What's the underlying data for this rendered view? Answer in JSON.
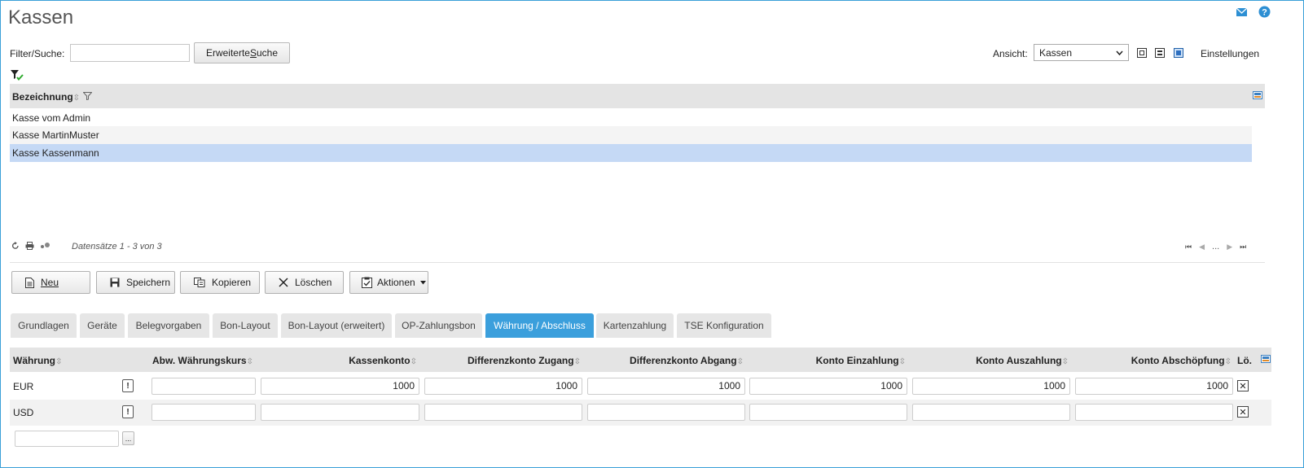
{
  "page": {
    "title": "Kassen"
  },
  "toolbar": {
    "filter_label": "Filter/Suche:",
    "filter_value": "",
    "advanced_search_pre": "Erweiterte ",
    "advanced_search_ul": "S",
    "advanced_search_post": "uche",
    "view_label": "Ansicht:",
    "view_selected": "Kassen",
    "settings_label": "Einstellungen"
  },
  "list": {
    "column_header": "Bezeichnung",
    "rows": [
      "Kasse vom Admin",
      "Kasse MartinMuster",
      "Kasse Kassenmann"
    ],
    "selected_index": 2,
    "records_text": "Datensätze 1 - 3 von 3",
    "pager_ellipsis": "..."
  },
  "actions": {
    "neu": "Neu",
    "speichern": "Speichern",
    "kopieren": "Kopieren",
    "loeschen": "Löschen",
    "aktionen": "Aktionen"
  },
  "tabs": [
    "Grundlagen",
    "Geräte",
    "Belegvorgaben",
    "Bon-Layout",
    "Bon-Layout (erweitert)",
    "OP-Zahlungsbon",
    "Währung / Abschluss",
    "Kartenzahlung",
    "TSE Konfiguration"
  ],
  "active_tab_index": 6,
  "currency_table": {
    "headers": {
      "waehrung": "Währung",
      "abw_kurs": "Abw. Währungskurs",
      "kassenkonto": "Kassenkonto",
      "diff_zugang": "Differenzkonto Zugang",
      "diff_abgang": "Differenzkonto Abgang",
      "konto_einzahlung": "Konto Einzahlung",
      "konto_auszahlung": "Konto Auszahlung",
      "konto_abschoepfung": "Konto Abschöpfung",
      "loeschen": "Lö."
    },
    "rows": [
      {
        "currency": "EUR",
        "abw_kurs": "",
        "kassenkonto": "1000",
        "diff_zugang": "1000",
        "diff_abgang": "1000",
        "konto_einzahlung": "1000",
        "konto_auszahlung": "1000",
        "konto_abschoepfung": "1000"
      },
      {
        "currency": "USD",
        "abw_kurs": "",
        "kassenkonto": "",
        "diff_zugang": "",
        "diff_abgang": "",
        "konto_einzahlung": "",
        "konto_auszahlung": "",
        "konto_abschoepfung": ""
      }
    ],
    "exclaim": "!",
    "lookup_button": "..."
  },
  "colors": {
    "accent": "#3b9fdc",
    "selected_row": "#c5d9f5",
    "header_bg": "#e4e4e4"
  }
}
